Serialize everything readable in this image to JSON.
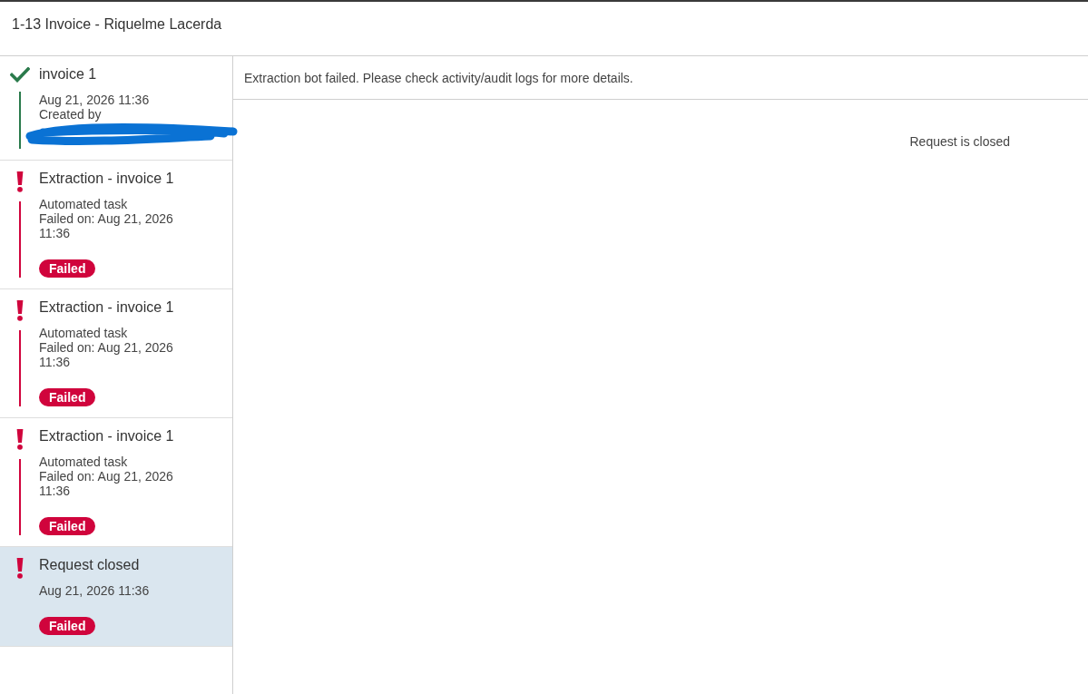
{
  "header": {
    "title": "1-13 Invoice - Riquelme Lacerda"
  },
  "timeline": [
    {
      "kind": "success",
      "title": "invoice 1",
      "details": [
        "Aug 21, 2026 11:36",
        "Created by"
      ],
      "creator_redacted": true,
      "selected": false
    },
    {
      "kind": "failed",
      "title": "Extraction - invoice 1",
      "details": [
        "Automated task",
        "Failed on: Aug 21, 2026 11:36"
      ],
      "badge": "Failed",
      "creator_redacted": false,
      "selected": false
    },
    {
      "kind": "failed",
      "title": "Extraction - invoice 1",
      "details": [
        "Automated task",
        "Failed on: Aug 21, 2026 11:36"
      ],
      "badge": "Failed",
      "creator_redacted": false,
      "selected": false
    },
    {
      "kind": "failed",
      "title": "Extraction - invoice 1",
      "details": [
        "Automated task",
        "Failed on: Aug 21, 2026 11:36"
      ],
      "badge": "Failed",
      "creator_redacted": false,
      "selected": false
    },
    {
      "kind": "failed",
      "title": "Request closed",
      "details": [
        "Aug 21, 2026 11:36"
      ],
      "badge": "Failed",
      "creator_redacted": false,
      "selected": true
    }
  ],
  "detail_panel": {
    "message": "Extraction bot failed. Please check activity/audit logs for more details.",
    "status_text": "Request is closed"
  }
}
